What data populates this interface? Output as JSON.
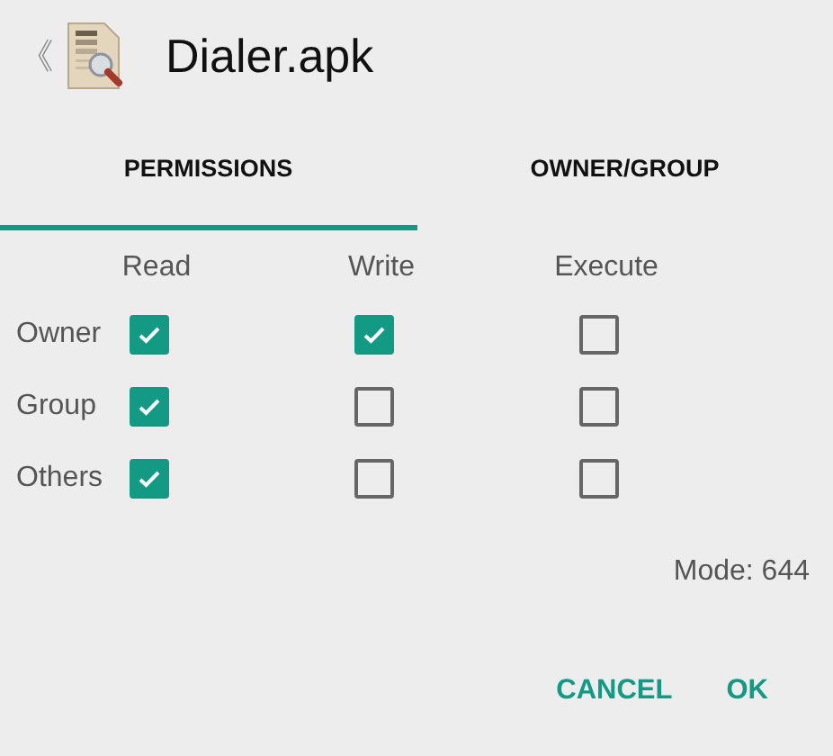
{
  "header": {
    "back": "《",
    "title": "Dialer.apk"
  },
  "tabs": [
    {
      "label": "PERMISSIONS",
      "selected": true
    },
    {
      "label": "OWNER/GROUP",
      "selected": false
    }
  ],
  "columns": [
    "Read",
    "Write",
    "Execute"
  ],
  "rows": [
    {
      "label": "Owner",
      "checks": [
        true,
        true,
        false
      ]
    },
    {
      "label": "Group",
      "checks": [
        true,
        false,
        false
      ]
    },
    {
      "label": "Others",
      "checks": [
        true,
        false,
        false
      ]
    }
  ],
  "mode": "Mode: 644",
  "buttons": [
    "CANCEL",
    "OK"
  ]
}
